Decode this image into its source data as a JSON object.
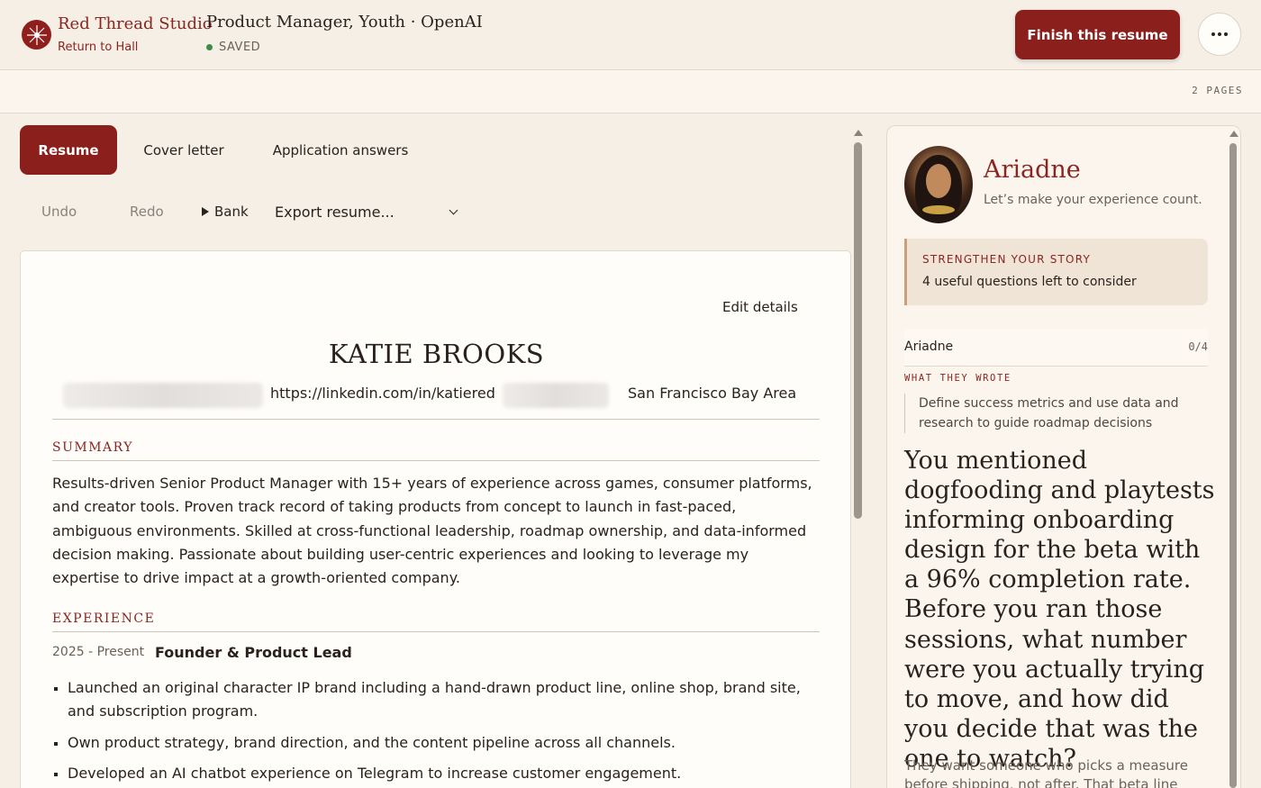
{
  "header": {
    "brand": "Red Thread Studio",
    "return_link": "Return to Hall",
    "doc_title": "Product Manager, Youth · OpenAI",
    "save_status": "SAVED",
    "finish_button": "Finish this resume",
    "more_icon": "more-horizontal-icon",
    "logo_icon": "compass-star-icon"
  },
  "pagebar": {
    "pages": "2 PAGES"
  },
  "tabs": [
    {
      "label": "Resume",
      "active": true
    },
    {
      "label": "Cover letter",
      "active": false
    },
    {
      "label": "Application answers",
      "active": false
    }
  ],
  "toolbar": {
    "undo": "Undo",
    "redo": "Redo",
    "bank": "Bank",
    "export": "Export resume..."
  },
  "resume": {
    "edit_details": "Edit details",
    "name": "KATIE BROOKS",
    "linkedin": "https://linkedin.com/in/katiered",
    "location": "San Francisco Bay Area",
    "summary_heading": "SUMMARY",
    "summary": "Results-driven Senior Product Manager with 15+ years of experience across games, consumer platforms, and creator tools. Proven track record of taking products from concept to launch in fast-paced, ambiguous environments. Skilled at cross-functional leadership, roadmap ownership, and data-informed decision making. Passionate about building user-centric experiences and looking to leverage my expertise to drive impact at a growth-oriented company.",
    "experience_heading": "EXPERIENCE",
    "experience": [
      {
        "dates": "2025 - Present",
        "role": "Founder & Product Lead",
        "bullets": [
          "Launched an original character IP brand including a hand-drawn product line, online shop, brand site, and subscription program.",
          "Own product strategy, brand direction, and the content pipeline across all channels.",
          "Developed an AI chatbot experience on Telegram to increase customer engagement."
        ]
      }
    ]
  },
  "coach": {
    "name": "Ariadne",
    "tagline": "Let’s make your experience count.",
    "callout_heading": "STRENGTHEN YOUR STORY",
    "callout_sub": "4 useful questions left to consider",
    "progress_name": "Ariadne",
    "progress_count": "0/4",
    "what_they_wrote_label": "WHAT THEY WROTE",
    "quote": "Define success metrics and use data and research to guide roadmap decisions",
    "question": "You mentioned dogfooding and playtests informing onboarding design for the beta with a 96% completion rate. Before you ran those sessions, what number were you actually trying to move, and how did you decide that was the one to watch?",
    "why": "They want someone who picks a measure before shipping, not after. That beta line already hints at"
  }
}
